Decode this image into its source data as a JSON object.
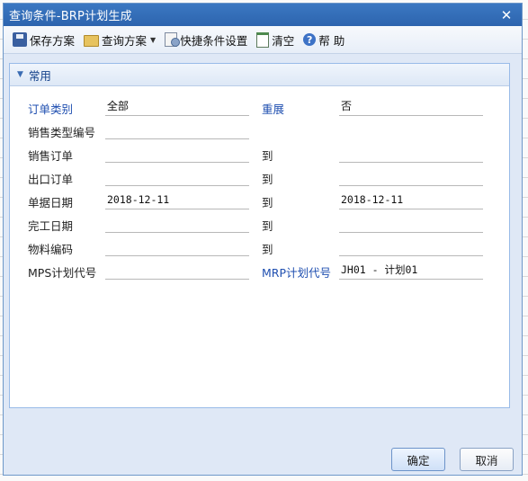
{
  "window": {
    "title": "查询条件-BRP计划生成"
  },
  "toolbar": {
    "save": "保存方案",
    "query": "查询方案",
    "quick": "快捷条件设置",
    "clear": "清空",
    "help": "帮 助"
  },
  "panel": {
    "header": "常用"
  },
  "form": {
    "order_type_label": "订单类别",
    "order_type_value": "全部",
    "reexpand_label": "重展",
    "reexpand_value": "否",
    "sales_type_label": "销售类型编号",
    "sales_order_label": "销售订单",
    "export_order_label": "出口订单",
    "doc_date_label": "单据日期",
    "doc_date_from": "2018-12-11",
    "doc_date_to": "2018-12-11",
    "finish_date_label": "完工日期",
    "material_label": "物料编码",
    "to_label": "到",
    "mps_label": "MPS计划代号",
    "mrp_label": "MRP计划代号",
    "mrp_value": "JH01 - 计划01"
  },
  "buttons": {
    "ok": "确定",
    "cancel": "取消"
  }
}
